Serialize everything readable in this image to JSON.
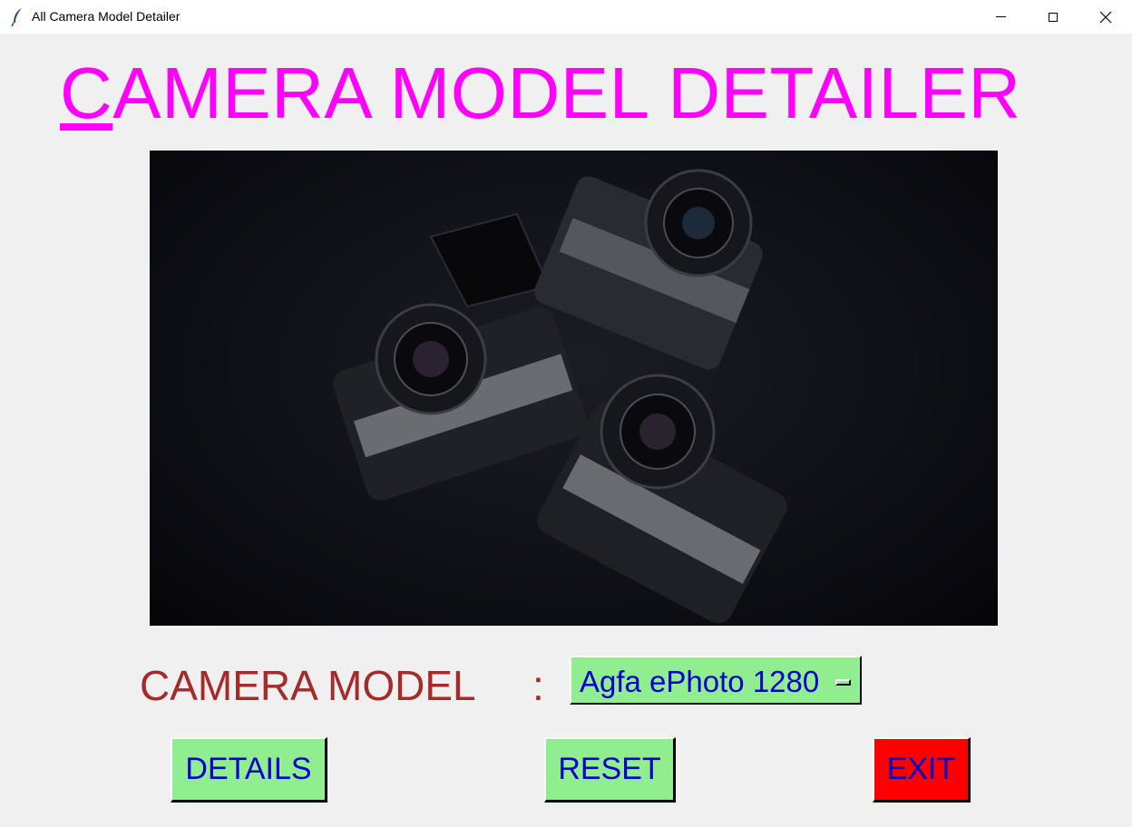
{
  "window": {
    "title": "All Camera Model Detailer",
    "icon": "feather-icon"
  },
  "heading": {
    "first_letter": "C",
    "rest": "AMERA MODEL DETAILER",
    "color": "#ff00ff"
  },
  "photo": {
    "description_icon": "cameras-photo"
  },
  "form": {
    "model_label": "CAMERA MODEL",
    "colon": ":",
    "selected_model": "Agfa ePhoto 1280"
  },
  "buttons": {
    "details": "DETAILS",
    "reset": "RESET",
    "exit": "EXIT"
  },
  "colors": {
    "button_bg": "#90ee90",
    "exit_bg": "#ff0000",
    "button_text": "#0000cd",
    "label_text": "#a52a2a"
  }
}
